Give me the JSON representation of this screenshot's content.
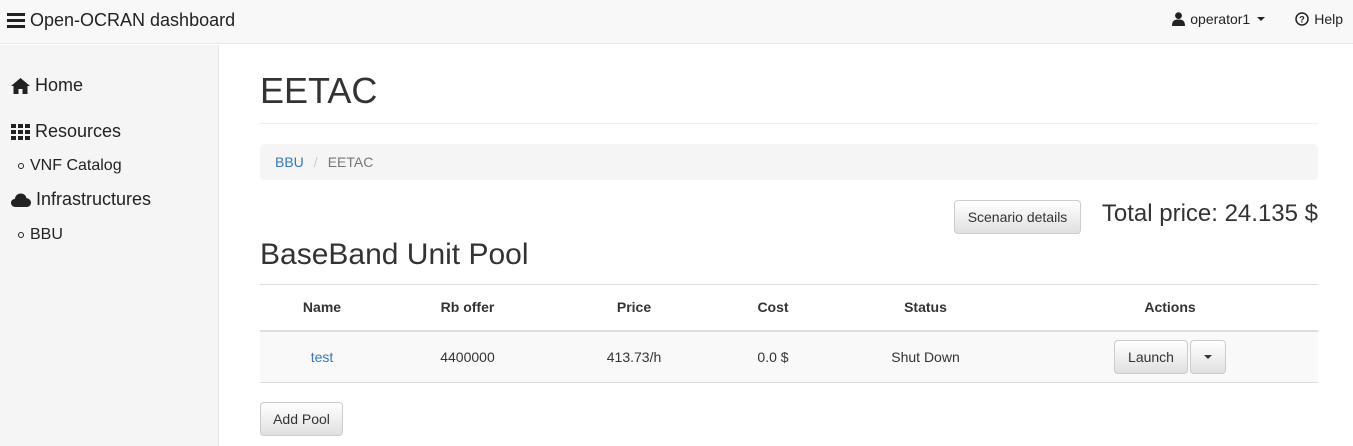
{
  "navbar": {
    "brand_title": "Open-OCRAN dashboard",
    "user_label": "operator1",
    "help_label": "Help"
  },
  "sidebar": {
    "items": [
      {
        "label": "Home",
        "icon": "home-icon"
      },
      {
        "label": "Resources",
        "icon": "grid-icon"
      },
      {
        "label": "VNF Catalog",
        "icon": "bullet"
      },
      {
        "label": "Infrastructures",
        "icon": "cloud-icon"
      },
      {
        "label": "BBU",
        "icon": "bullet"
      }
    ]
  },
  "main": {
    "page_title": "EETAC",
    "breadcrumb": [
      {
        "label": "BBU"
      },
      {
        "label": "EETAC"
      }
    ],
    "breadcrumb_separator": "/",
    "scenario_button": "Scenario details",
    "total_price": "Total price: 24.135 $",
    "section_title": "BaseBand Unit Pool",
    "table": {
      "headers": [
        "Name",
        "Rb offer",
        "Price",
        "Cost",
        "Status",
        "Actions"
      ],
      "rows": [
        {
          "name": "test",
          "rb_offer": "4400000",
          "price": "413.73/h",
          "cost": "0.0 $",
          "status": "Shut Down",
          "action_label": "Launch"
        }
      ]
    },
    "add_pool_button": "Add Pool"
  },
  "colors": {
    "link": "#337ab7",
    "navbar_bg": "#f8f8f8",
    "sidebar_bg": "#f5f5f5"
  }
}
